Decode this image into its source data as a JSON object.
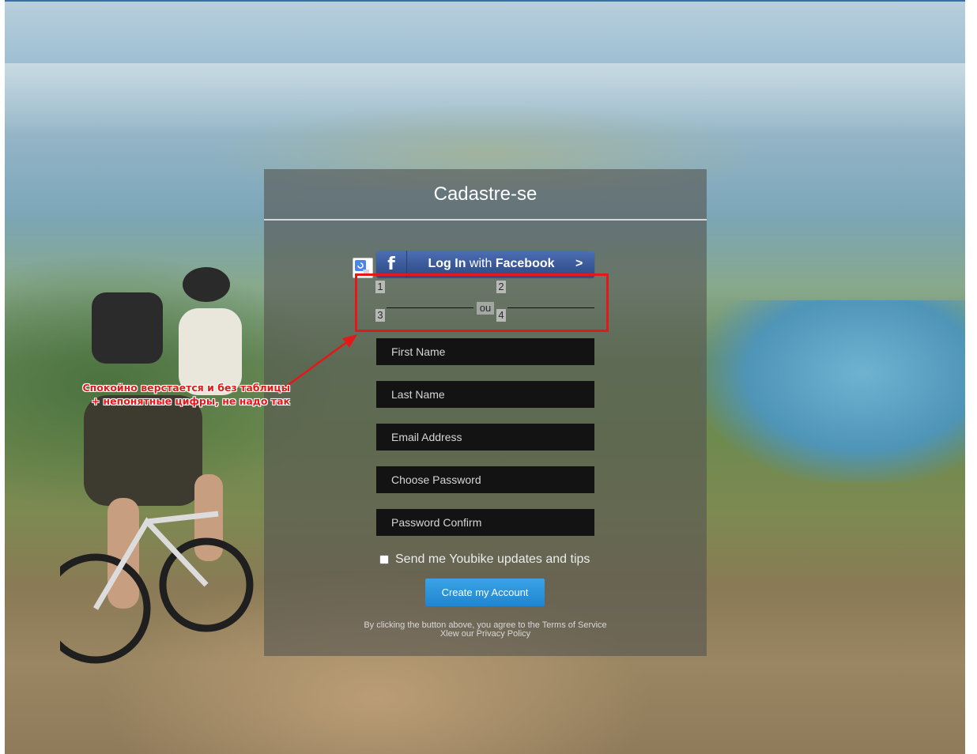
{
  "panel": {
    "title": "Cadastre-se"
  },
  "facebook": {
    "label_bold_1": "Log",
    "label_bold_2": "In",
    "label_mid": "with",
    "label_bold_3": "Facebook",
    "chevron": ">"
  },
  "divider": {
    "numbers": [
      "1",
      "2",
      "3",
      "4"
    ],
    "or_text": "ou"
  },
  "fields": [
    {
      "placeholder": "First Name"
    },
    {
      "placeholder": "Last Name"
    },
    {
      "placeholder": "Email Address"
    },
    {
      "placeholder": "Choose Password"
    },
    {
      "placeholder": "Password Confirm"
    }
  ],
  "checkbox": {
    "label": "Send me Youbike updates and tips",
    "checked": false
  },
  "create_button": {
    "label": "Create my Account"
  },
  "terms": {
    "line1": "By clicking the button above, you agree to the Terms of Service",
    "line2": "Xlew our Privacy Policy"
  },
  "annotation": {
    "line1": "Спокойно верстается и без таблицы",
    "line2": "+ непонятные цифры, не надо так"
  },
  "colors": {
    "annotation_red": "#e31818",
    "facebook_blue": "#3b5998",
    "create_button_blue": "#2185cf"
  }
}
